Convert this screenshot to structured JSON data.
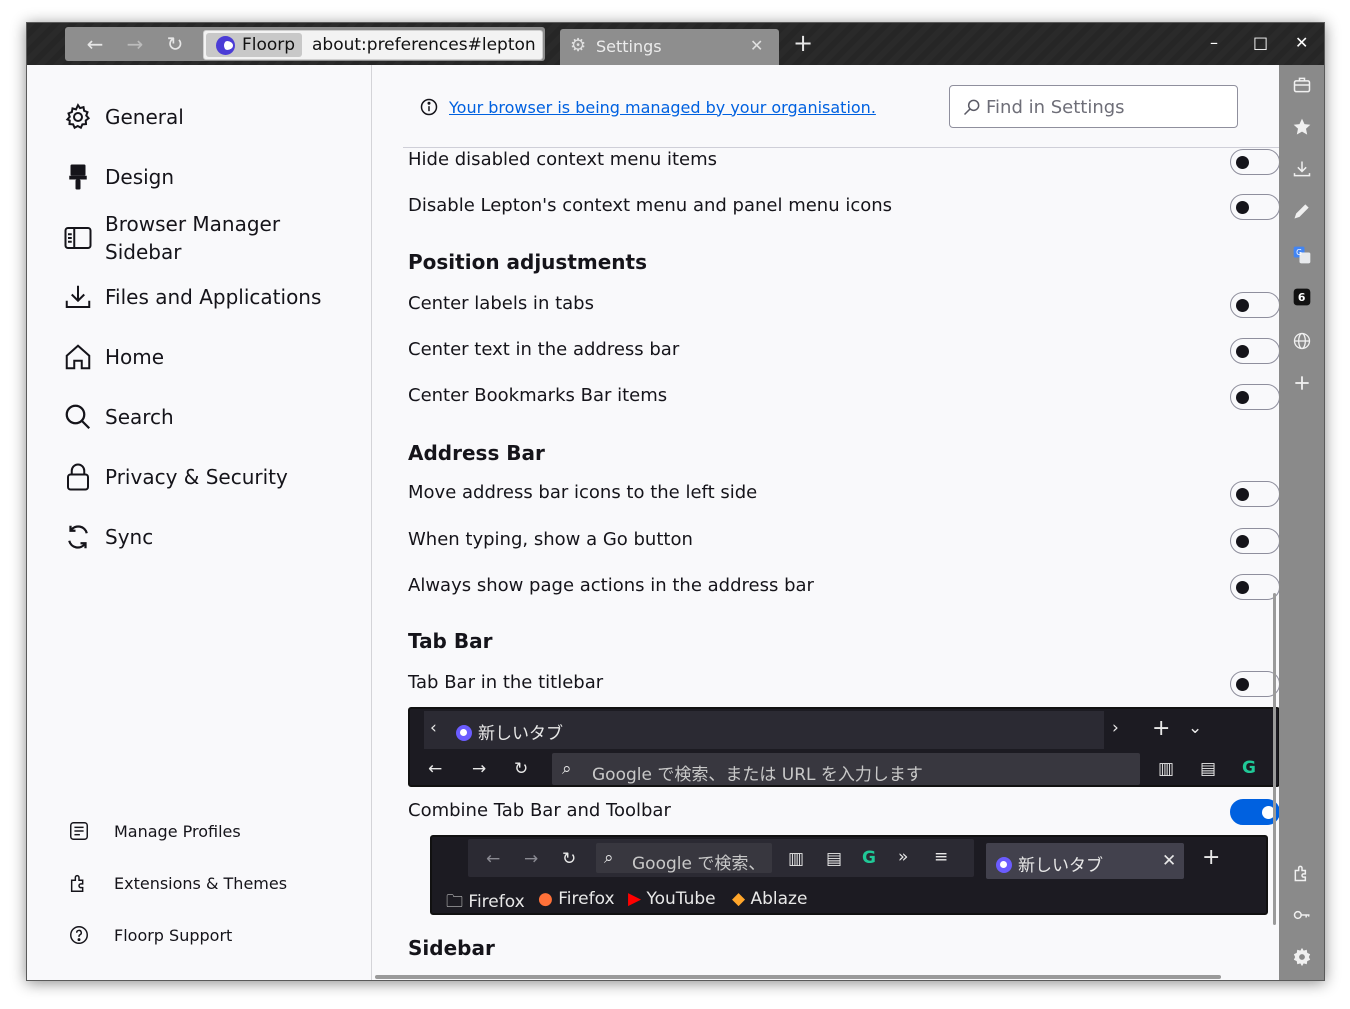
{
  "titlebar": {
    "identity_label": "Floorp",
    "url": "about:preferences#lepton",
    "tab_title": "Settings",
    "new_tab_glyph": "+",
    "nav_back_glyph": "←",
    "nav_forward_glyph": "→",
    "reload_glyph": "↻",
    "minimize_glyph": "–",
    "maximize_glyph": "□",
    "close_glyph": "✕"
  },
  "sidebar": {
    "categories": [
      {
        "label": "General",
        "icon": "gear-icon"
      },
      {
        "label": "Design",
        "icon": "paintbrush-icon"
      },
      {
        "label": "Browser Manager Sidebar",
        "icon": "sidebar-icon"
      },
      {
        "label": "Files and Applications",
        "icon": "download-icon"
      },
      {
        "label": "Home",
        "icon": "home-icon"
      },
      {
        "label": "Search",
        "icon": "search-icon"
      },
      {
        "label": "Privacy & Security",
        "icon": "lock-icon"
      },
      {
        "label": "Sync",
        "icon": "sync-icon"
      }
    ],
    "footer": [
      {
        "label": "Manage Profiles",
        "icon": "profile-icon"
      },
      {
        "label": "Extensions & Themes",
        "icon": "puzzle-icon"
      },
      {
        "label": "Floorp Support",
        "icon": "help-icon"
      }
    ]
  },
  "main": {
    "policy_link": "Your browser is being managed by your organisation.",
    "search_placeholder": "Find in Settings",
    "rows": {
      "hide_disabled": "Hide disabled context menu items",
      "disable_icons": "Disable Lepton's context menu and panel menu icons",
      "center_tabs": "Center labels in tabs",
      "center_address": "Center text in the address bar",
      "center_bookmarks": "Center Bookmarks Bar items",
      "move_icons": "Move address bar icons to the left side",
      "go_button": "When typing, show a Go button",
      "page_actions": "Always show page actions in the address bar",
      "tabbar_titlebar": "Tab Bar in the titlebar",
      "combine_tabbar": "Combine Tab Bar and Toolbar"
    },
    "headings": {
      "position": "Position adjustments",
      "address": "Address Bar",
      "tabbar": "Tab Bar",
      "sidebar": "Sidebar"
    },
    "toggles": {
      "hide_disabled": false,
      "disable_icons": false,
      "center_tabs": false,
      "center_address": false,
      "center_bookmarks": false,
      "move_icons": false,
      "go_button": false,
      "page_actions": false,
      "tabbar_titlebar": false,
      "combine_tabbar": true
    },
    "preview": {
      "tab_title": "新しいタブ",
      "url_placeholder": "Google で検索、または URL を入力します",
      "url_placeholder_short": "Google で検索、",
      "bookmarks": [
        "Firefox",
        "Firefox",
        "YouTube",
        "Ablaze"
      ]
    }
  }
}
